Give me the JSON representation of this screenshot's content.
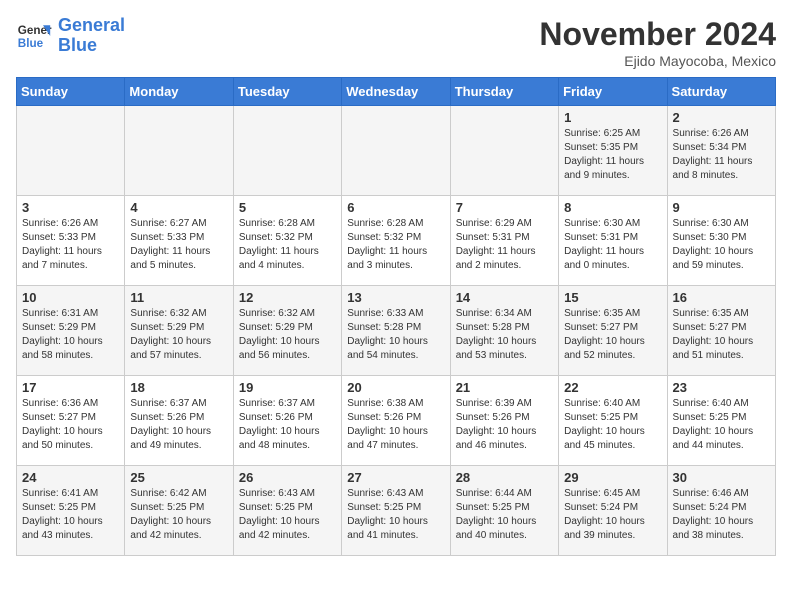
{
  "logo": {
    "name1": "General",
    "name2": "Blue"
  },
  "title": "November 2024",
  "location": "Ejido Mayocoba, Mexico",
  "days_of_week": [
    "Sunday",
    "Monday",
    "Tuesday",
    "Wednesday",
    "Thursday",
    "Friday",
    "Saturday"
  ],
  "weeks": [
    [
      {
        "day": "",
        "info": ""
      },
      {
        "day": "",
        "info": ""
      },
      {
        "day": "",
        "info": ""
      },
      {
        "day": "",
        "info": ""
      },
      {
        "day": "",
        "info": ""
      },
      {
        "day": "1",
        "info": "Sunrise: 6:25 AM\nSunset: 5:35 PM\nDaylight: 11 hours and 9 minutes."
      },
      {
        "day": "2",
        "info": "Sunrise: 6:26 AM\nSunset: 5:34 PM\nDaylight: 11 hours and 8 minutes."
      }
    ],
    [
      {
        "day": "3",
        "info": "Sunrise: 6:26 AM\nSunset: 5:33 PM\nDaylight: 11 hours and 7 minutes."
      },
      {
        "day": "4",
        "info": "Sunrise: 6:27 AM\nSunset: 5:33 PM\nDaylight: 11 hours and 5 minutes."
      },
      {
        "day": "5",
        "info": "Sunrise: 6:28 AM\nSunset: 5:32 PM\nDaylight: 11 hours and 4 minutes."
      },
      {
        "day": "6",
        "info": "Sunrise: 6:28 AM\nSunset: 5:32 PM\nDaylight: 11 hours and 3 minutes."
      },
      {
        "day": "7",
        "info": "Sunrise: 6:29 AM\nSunset: 5:31 PM\nDaylight: 11 hours and 2 minutes."
      },
      {
        "day": "8",
        "info": "Sunrise: 6:30 AM\nSunset: 5:31 PM\nDaylight: 11 hours and 0 minutes."
      },
      {
        "day": "9",
        "info": "Sunrise: 6:30 AM\nSunset: 5:30 PM\nDaylight: 10 hours and 59 minutes."
      }
    ],
    [
      {
        "day": "10",
        "info": "Sunrise: 6:31 AM\nSunset: 5:29 PM\nDaylight: 10 hours and 58 minutes."
      },
      {
        "day": "11",
        "info": "Sunrise: 6:32 AM\nSunset: 5:29 PM\nDaylight: 10 hours and 57 minutes."
      },
      {
        "day": "12",
        "info": "Sunrise: 6:32 AM\nSunset: 5:29 PM\nDaylight: 10 hours and 56 minutes."
      },
      {
        "day": "13",
        "info": "Sunrise: 6:33 AM\nSunset: 5:28 PM\nDaylight: 10 hours and 54 minutes."
      },
      {
        "day": "14",
        "info": "Sunrise: 6:34 AM\nSunset: 5:28 PM\nDaylight: 10 hours and 53 minutes."
      },
      {
        "day": "15",
        "info": "Sunrise: 6:35 AM\nSunset: 5:27 PM\nDaylight: 10 hours and 52 minutes."
      },
      {
        "day": "16",
        "info": "Sunrise: 6:35 AM\nSunset: 5:27 PM\nDaylight: 10 hours and 51 minutes."
      }
    ],
    [
      {
        "day": "17",
        "info": "Sunrise: 6:36 AM\nSunset: 5:27 PM\nDaylight: 10 hours and 50 minutes."
      },
      {
        "day": "18",
        "info": "Sunrise: 6:37 AM\nSunset: 5:26 PM\nDaylight: 10 hours and 49 minutes."
      },
      {
        "day": "19",
        "info": "Sunrise: 6:37 AM\nSunset: 5:26 PM\nDaylight: 10 hours and 48 minutes."
      },
      {
        "day": "20",
        "info": "Sunrise: 6:38 AM\nSunset: 5:26 PM\nDaylight: 10 hours and 47 minutes."
      },
      {
        "day": "21",
        "info": "Sunrise: 6:39 AM\nSunset: 5:26 PM\nDaylight: 10 hours and 46 minutes."
      },
      {
        "day": "22",
        "info": "Sunrise: 6:40 AM\nSunset: 5:25 PM\nDaylight: 10 hours and 45 minutes."
      },
      {
        "day": "23",
        "info": "Sunrise: 6:40 AM\nSunset: 5:25 PM\nDaylight: 10 hours and 44 minutes."
      }
    ],
    [
      {
        "day": "24",
        "info": "Sunrise: 6:41 AM\nSunset: 5:25 PM\nDaylight: 10 hours and 43 minutes."
      },
      {
        "day": "25",
        "info": "Sunrise: 6:42 AM\nSunset: 5:25 PM\nDaylight: 10 hours and 42 minutes."
      },
      {
        "day": "26",
        "info": "Sunrise: 6:43 AM\nSunset: 5:25 PM\nDaylight: 10 hours and 42 minutes."
      },
      {
        "day": "27",
        "info": "Sunrise: 6:43 AM\nSunset: 5:25 PM\nDaylight: 10 hours and 41 minutes."
      },
      {
        "day": "28",
        "info": "Sunrise: 6:44 AM\nSunset: 5:25 PM\nDaylight: 10 hours and 40 minutes."
      },
      {
        "day": "29",
        "info": "Sunrise: 6:45 AM\nSunset: 5:24 PM\nDaylight: 10 hours and 39 minutes."
      },
      {
        "day": "30",
        "info": "Sunrise: 6:46 AM\nSunset: 5:24 PM\nDaylight: 10 hours and 38 minutes."
      }
    ]
  ]
}
